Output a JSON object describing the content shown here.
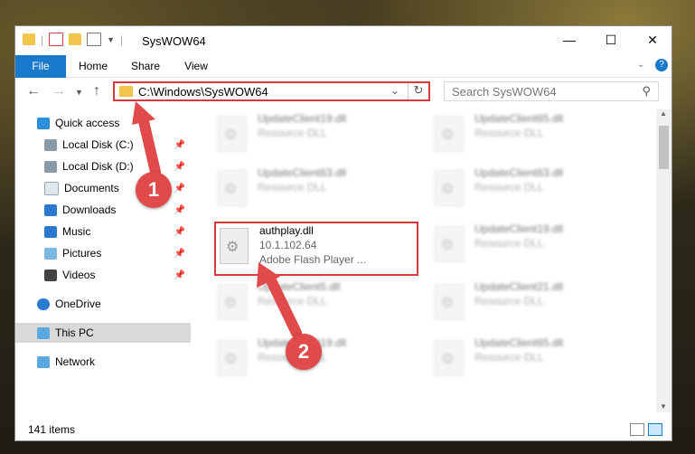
{
  "window": {
    "title": "SysWOW64",
    "controls": {
      "minimize": "—",
      "maximize": "☐",
      "close": "✕"
    }
  },
  "ribbon": {
    "tabs": [
      {
        "label": "File"
      },
      {
        "label": "Home"
      },
      {
        "label": "Share"
      },
      {
        "label": "View"
      }
    ]
  },
  "navigation": {
    "address": "C:\\Windows\\SysWOW64",
    "search_placeholder": "Search SysWOW64"
  },
  "sidebar": {
    "items": [
      {
        "label": "Quick access",
        "icon": "star-icon"
      },
      {
        "label": "Local Disk (C:)",
        "icon": "drive-icon",
        "pinned": true
      },
      {
        "label": "Local Disk (D:)",
        "icon": "drive-icon",
        "pinned": true
      },
      {
        "label": "Documents",
        "icon": "documents-icon",
        "pinned": true
      },
      {
        "label": "Downloads",
        "icon": "download-icon",
        "pinned": true
      },
      {
        "label": "Music",
        "icon": "music-icon",
        "pinned": true
      },
      {
        "label": "Pictures",
        "icon": "pictures-icon",
        "pinned": true
      },
      {
        "label": "Videos",
        "icon": "videos-icon",
        "pinned": true
      },
      {
        "label": "OneDrive",
        "icon": "cloud-icon"
      },
      {
        "label": "This PC",
        "icon": "computer-icon",
        "selected": true
      },
      {
        "label": "Network",
        "icon": "network-icon"
      }
    ]
  },
  "files": [
    {
      "name": "UpdateClient19.dll",
      "type": "Resource DLL"
    },
    {
      "name": "UpdateClient65.dll",
      "type": "Resource DLL"
    },
    {
      "name": "UpdateClient63.dll",
      "type": "Resource DLL"
    },
    {
      "name": "UpdateClient63.dll",
      "type": "Resource DLL"
    },
    {
      "name": "authplay.dll",
      "version": "10.1.102.64",
      "type": "Adobe Flash Player ..."
    },
    {
      "name": "UpdateClient19.dll",
      "type": "Resource DLL"
    },
    {
      "name": "UpdateClient5.dll",
      "type": "Resource DLL"
    },
    {
      "name": "UpdateClient21.dll",
      "type": "Resource DLL"
    },
    {
      "name": "UpdateClient19.dll",
      "type": "Resource DLL"
    },
    {
      "name": "UpdateClient65.dll",
      "type": "Resource DLL"
    }
  ],
  "status": {
    "item_count": "141 items"
  },
  "annotations": {
    "marker1": "1",
    "marker2": "2"
  },
  "colors": {
    "accent": "#1979ca",
    "highlight": "#d9393e",
    "arrow": "#e04a4a"
  }
}
